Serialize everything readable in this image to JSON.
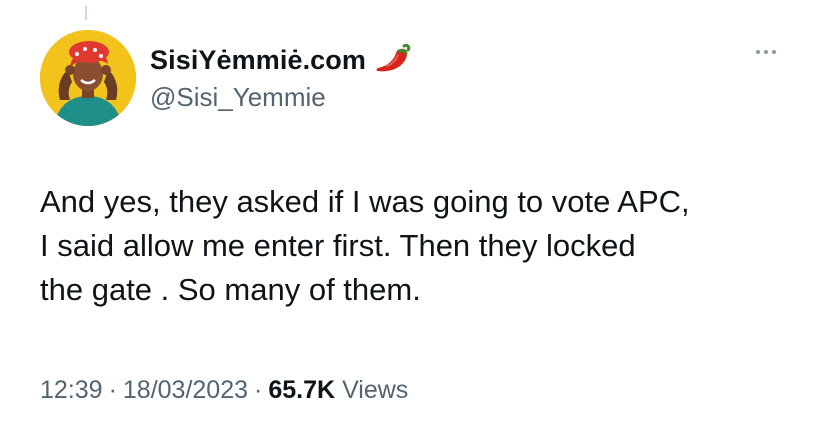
{
  "author": {
    "display_name": "SisiYėmmiė.com",
    "handle": "@Sisi_Yemmie",
    "emoji": "chili-pepper-icon"
  },
  "tweet": {
    "lines": [
      "And yes, they asked if I was going to vote APC,",
      "I said allow me enter first. Then they locked",
      "the gate . So many of them."
    ]
  },
  "meta": {
    "time": "12:39",
    "separator": "·",
    "date": "18/03/2023",
    "views_count": "65.7K",
    "views_label": "Views"
  },
  "colors": {
    "text": "#0f1419",
    "secondary": "#536471",
    "avatar_bg": "#f2c31b",
    "chili": "#d6241f"
  }
}
